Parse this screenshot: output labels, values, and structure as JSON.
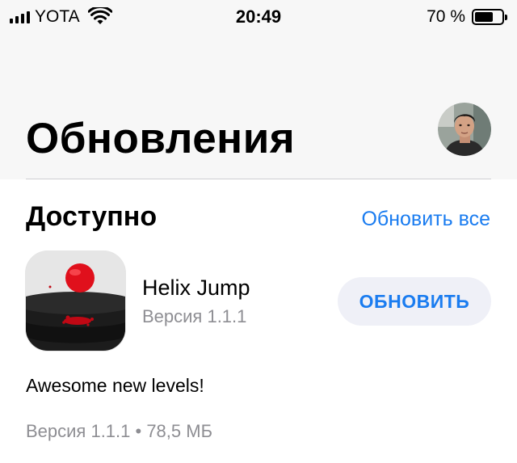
{
  "status_bar": {
    "carrier": "YOTA",
    "time": "20:49",
    "battery_text": "70 %",
    "battery_level": 0.7,
    "signal_bars": 4
  },
  "header": {
    "title": "Обновления",
    "avatar_icon": "profile-avatar"
  },
  "section": {
    "title": "Доступно",
    "update_all_label": "Обновить все"
  },
  "app": {
    "name": "Helix Jump",
    "version": "Версия 1.1.1",
    "update_label": "ОБНОВИТЬ",
    "release_notes": "Awesome new levels!",
    "meta": "Версия 1.1.1 • 78,5 МБ"
  },
  "colors": {
    "accent": "#1a7cf0",
    "secondary_text": "#8e8e93",
    "button_bg": "#eff0f7",
    "header_bg": "#f7f7f7"
  }
}
